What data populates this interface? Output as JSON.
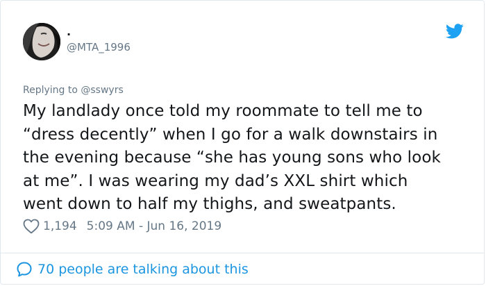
{
  "user": {
    "display_name": ".",
    "handle": "@MTA_1996",
    "avatar_icon": "profile-photo"
  },
  "brand": {
    "icon": "twitter-bird-icon",
    "color": "#1da1f2"
  },
  "reply": {
    "prefix": "Replying to ",
    "mention": "@sswyrs"
  },
  "tweet": {
    "text": "My landlady once told my roommate to tell me to\n“dress decently” when I go for a walk downstairs in\nthe evening because “she has young sons who look\nat me”. I was wearing my dad’s XXL shirt which\nwent down to half my thighs, and sweatpants."
  },
  "meta": {
    "like_icon": "heart-icon",
    "like_count": "1,194",
    "timestamp": "5:09 AM - Jun 16, 2019"
  },
  "footer": {
    "icon": "speech-bubble-icon",
    "talking_label": "70 people are talking about this",
    "link_color": "#1b95e0"
  }
}
